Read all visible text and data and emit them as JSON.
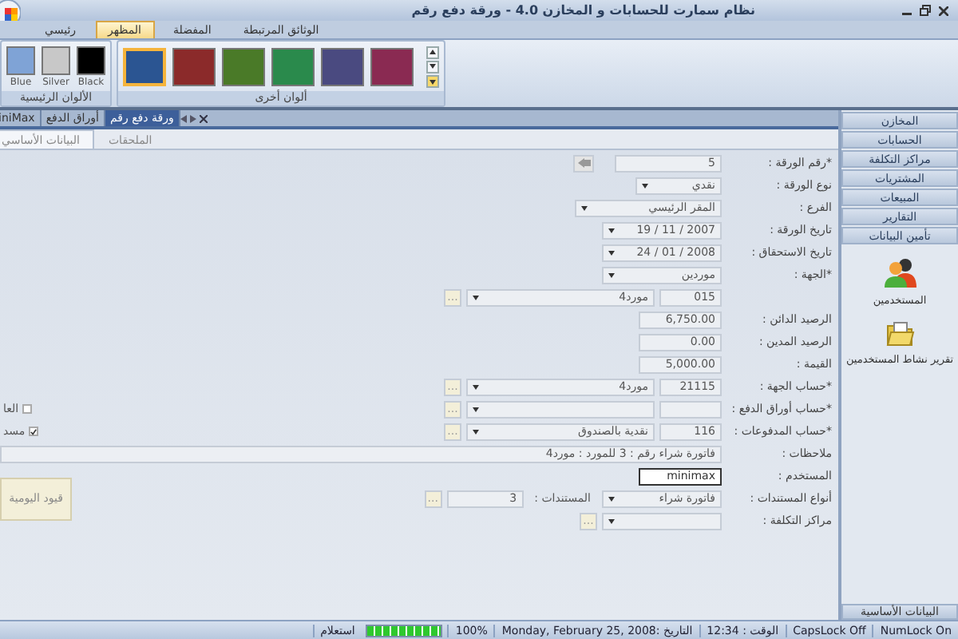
{
  "window": {
    "title": "نظام سمارت للحسابات و المخازن 4.0 - ورقة دفع رقم"
  },
  "ribbon_tabs": [
    {
      "label": "الوثائق المرتبطة",
      "selected": false
    },
    {
      "label": "المفضلة",
      "selected": false
    },
    {
      "label": "المظهر",
      "selected": true
    },
    {
      "label": "رئيسي",
      "selected": false
    }
  ],
  "ribbon_groups": [
    {
      "caption": "ألوان أخرى",
      "kind": "gallery",
      "swatches": [
        {
          "color": "#8a2a52",
          "selected": false
        },
        {
          "color": "#4a4a80",
          "selected": false
        },
        {
          "color": "#2a8a4c",
          "selected": false
        },
        {
          "color": "#4a7a28",
          "selected": false
        },
        {
          "color": "#8b2a2a",
          "selected": false
        },
        {
          "color": "#2b5592",
          "selected": true
        }
      ]
    },
    {
      "caption": "الألوان الرئيسية",
      "kind": "named",
      "swatches": [
        {
          "label": "Black",
          "color": "#000000",
          "selected": false
        },
        {
          "label": "Silver",
          "color": "#c8c8c8",
          "selected": false
        },
        {
          "label": "Blue",
          "color": "#7fa3d6",
          "selected": false
        }
      ]
    }
  ],
  "document_tabs": [
    {
      "label": "ورقة دفع رقم",
      "selected": true
    },
    {
      "label": "أوراق الدفع",
      "selected": false
    },
    {
      "label": "iniMax",
      "selected": false
    }
  ],
  "form_tabs": [
    {
      "label": "الملحقات",
      "selected": false
    },
    {
      "label": "البيانات الأساسي",
      "selected": true
    }
  ],
  "form_rows": [
    {
      "label": "*رقم الورقة :",
      "fields": [
        {
          "kind": "input",
          "value": "5"
        },
        {
          "kind": "icon_button"
        }
      ]
    },
    {
      "label": "نوع الورقة :",
      "fields": [
        {
          "kind": "select",
          "value": "نقدي"
        }
      ]
    },
    {
      "label": "الفرع :",
      "fields": [
        {
          "kind": "select",
          "value": "المقر الرئيسي"
        }
      ]
    },
    {
      "label": "تاريخ الورقة :",
      "fields": [
        {
          "kind": "select",
          "value": "2007 / 11 / 19"
        }
      ]
    },
    {
      "label": "تاريخ الاستحقاق :",
      "fields": [
        {
          "kind": "select",
          "value": "2008 / 01 / 24"
        }
      ]
    },
    {
      "label": "*الجهة :",
      "fields": [
        {
          "kind": "select",
          "value": "موردين"
        }
      ]
    },
    {
      "fields": [
        {
          "kind": "input",
          "value": "015"
        },
        {
          "kind": "select",
          "value": "مورد4"
        },
        {
          "kind": "browse",
          "value": "..."
        }
      ]
    },
    {
      "label": "الرصيد الدائن :",
      "fields": [
        {
          "kind": "input",
          "value": "6,750.00"
        }
      ]
    },
    {
      "label": "الرصيد المدين :",
      "fields": [
        {
          "kind": "input",
          "value": "0.00"
        }
      ]
    },
    {
      "label": "القيمة :",
      "fields": [
        {
          "kind": "input",
          "value": "5,000.00"
        }
      ]
    },
    {
      "label": "*حساب الجهة :",
      "fields": [
        {
          "kind": "input",
          "value": "21115"
        },
        {
          "kind": "select",
          "value": "مورد4"
        },
        {
          "kind": "browse",
          "value": "..."
        }
      ]
    },
    {
      "label": "*حساب أوراق الدفع :",
      "fields": [
        {
          "kind": "input"
        },
        {
          "kind": "select"
        },
        {
          "kind": "browse",
          "value": "..."
        }
      ]
    },
    {
      "label": "*حساب المدفوعات :",
      "fields": [
        {
          "kind": "input",
          "value": "116"
        },
        {
          "kind": "select",
          "value": "نقدية بالصندوق"
        },
        {
          "kind": "browse",
          "value": "..."
        }
      ]
    },
    {
      "label": "ملاحظات :",
      "fields": [
        {
          "kind": "input",
          "value": "فاتورة شراء رقم : 3 للمورد : مورد4"
        }
      ]
    },
    {
      "label": "المستخدم :",
      "fields": [
        {
          "kind": "input",
          "value": "minimax",
          "focused": true
        }
      ]
    },
    {
      "label": "أنواع المستندات :",
      "fields": [
        {
          "kind": "select",
          "value": "فاتورة شراء"
        },
        {
          "kind": "caption",
          "value": "المستندات :"
        },
        {
          "kind": "input",
          "value": "3"
        },
        {
          "kind": "browse",
          "value": "..."
        }
      ]
    },
    {
      "label": "مراكز التكلفة :",
      "fields": [
        {
          "kind": "select"
        },
        {
          "kind": "browse",
          "value": "..."
        }
      ]
    }
  ],
  "options": [
    {
      "label": "العا",
      "checked": false
    },
    {
      "label": "مسد",
      "checked": true
    }
  ],
  "journal_button": "قيود اليومية",
  "sidebar": {
    "items": [
      "المخازن",
      "الحسابات",
      "مراكز التكلفة",
      "المشتريات",
      "المبيعات",
      "التقارير",
      "تأمين البيانات"
    ],
    "shortcuts": [
      {
        "kind": "users",
        "label": "المستخدمين"
      },
      {
        "kind": "report",
        "label": "تقرير نشاط المستخدمين"
      }
    ],
    "footer": "البيانات الأساسية"
  },
  "status_bar": {
    "mode": "استعلام",
    "progress": {
      "level": 1
    },
    "zoom": "100%",
    "date": "التاريخ :Monday, February 25, 2008",
    "time": "الوقت : 12:34",
    "caps": "CapsLock Off",
    "num": "NumLock On"
  }
}
